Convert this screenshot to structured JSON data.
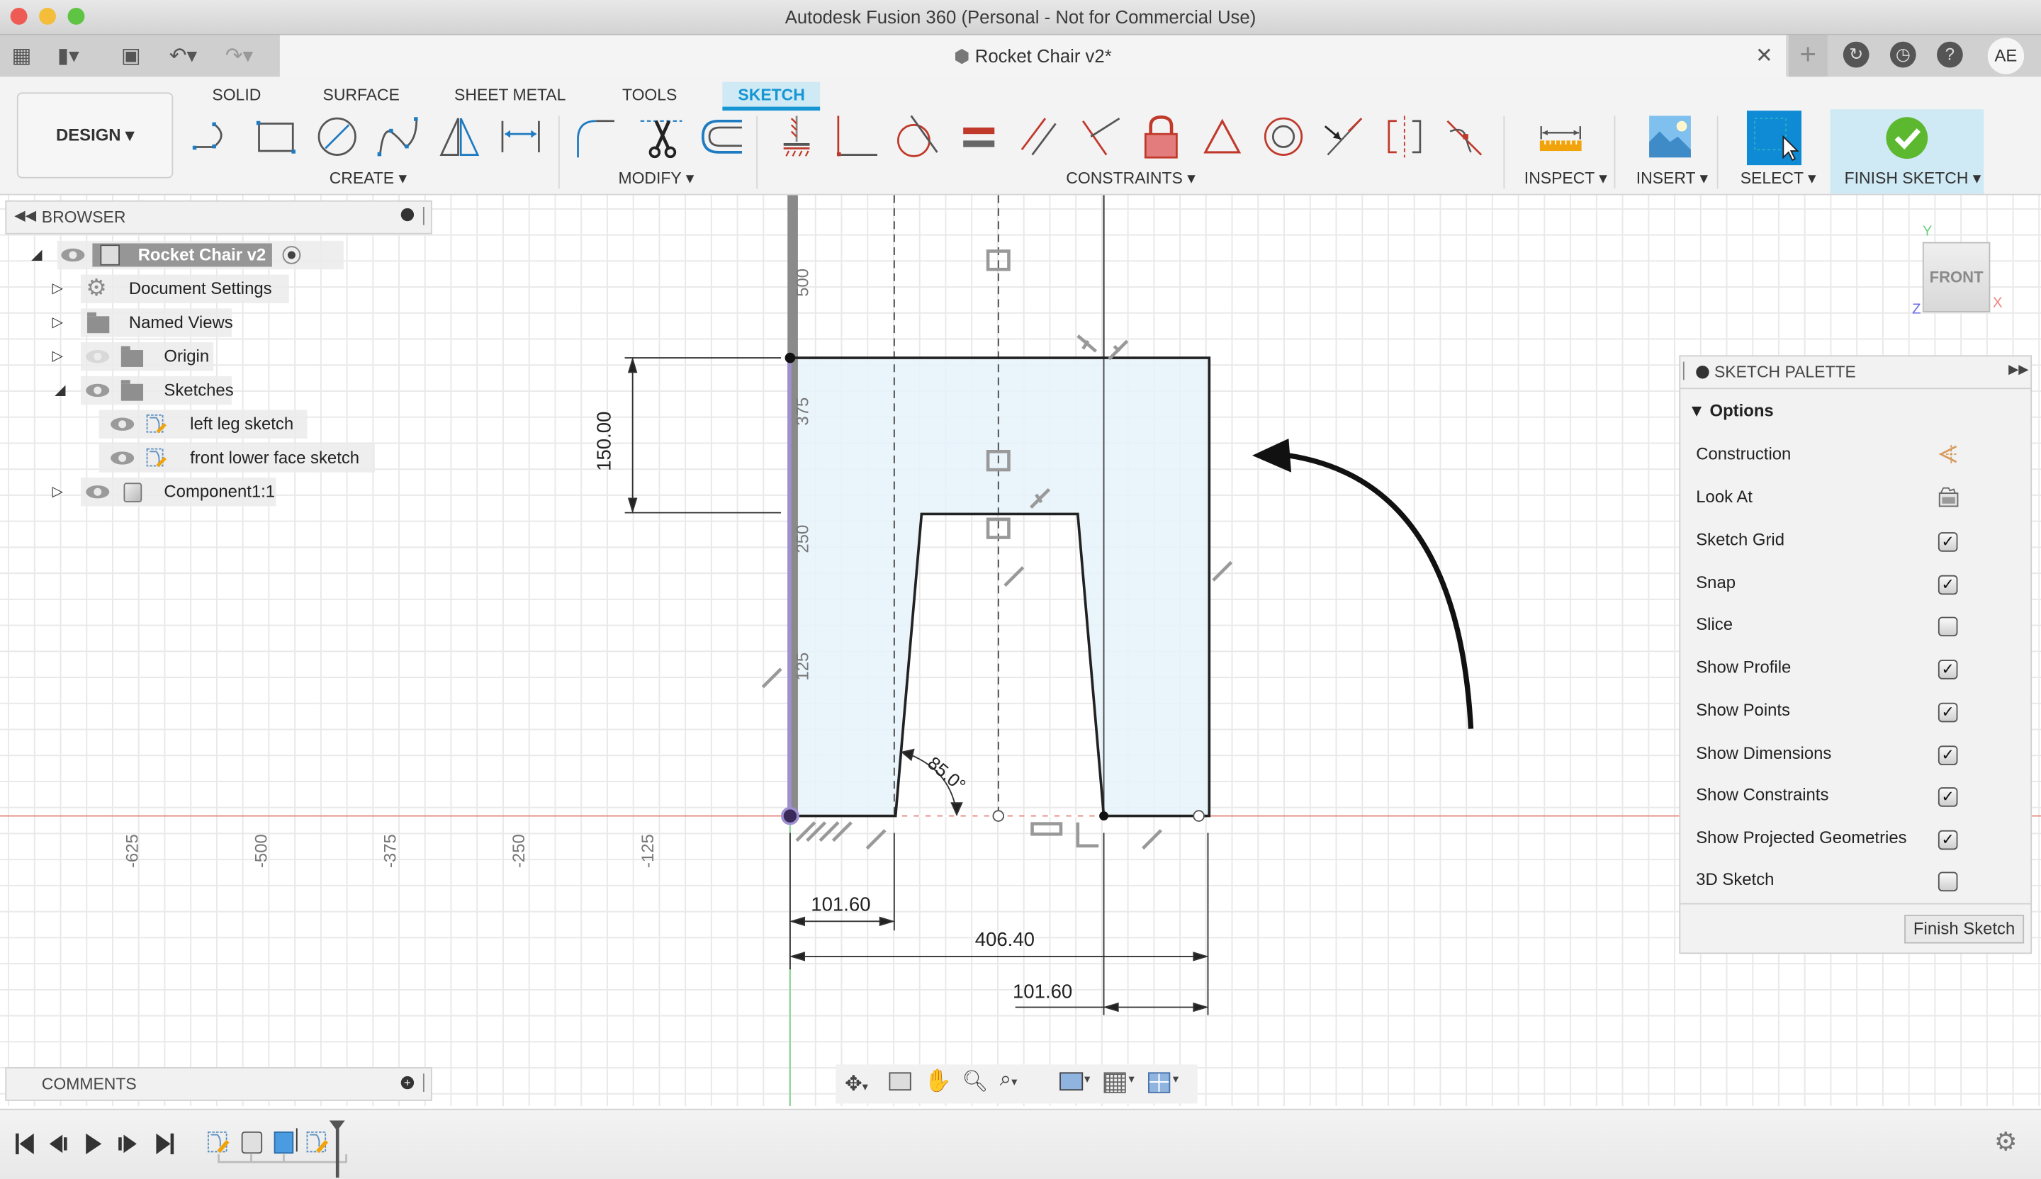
{
  "window": {
    "title": "Autodesk Fusion 360 (Personal - Not for Commercial Use)",
    "document_tab": "Rocket Chair v2*",
    "avatar_initials": "AE"
  },
  "ribbon": {
    "workspace": "DESIGN",
    "tabs": [
      {
        "label": "SOLID",
        "active": false
      },
      {
        "label": "SURFACE",
        "active": false
      },
      {
        "label": "SHEET METAL",
        "active": false
      },
      {
        "label": "TOOLS",
        "active": false
      },
      {
        "label": "SKETCH",
        "active": true
      }
    ],
    "groups": {
      "create": "CREATE",
      "modify": "MODIFY",
      "constraints": "CONSTRAINTS",
      "inspect": "INSPECT",
      "insert": "INSERT",
      "select": "SELECT",
      "finish_sketch": "FINISH SKETCH"
    },
    "create_tools": [
      "line-icon",
      "rectangle-icon",
      "circle-icon",
      "spline-icon",
      "mirror-icon",
      "dimension-icon"
    ],
    "modify_tools": [
      "fillet-icon",
      "trim-icon",
      "offset-icon"
    ],
    "constraint_tools": [
      "fix-icon",
      "coincident-icon",
      "tangent-icon",
      "equal-icon",
      "parallel-icon",
      "perpendicular-icon",
      "lock-icon",
      "horizontal-vertical-icon",
      "concentric-icon",
      "midpoint-icon",
      "symmetry-icon",
      "curvature-icon"
    ],
    "colors": {
      "accent": "#1596d3",
      "finish_green": "#5cb82e",
      "constraint_red": "#c0392b",
      "inspect_orange": "#f0a30a"
    }
  },
  "browser": {
    "title": "BROWSER",
    "items": [
      {
        "label": "Rocket Chair v2",
        "level": 0,
        "expanded": true,
        "icon": "component-icon",
        "visible": true,
        "selected": true
      },
      {
        "label": "Document Settings",
        "level": 1,
        "expanded": false,
        "icon": "gear-icon"
      },
      {
        "label": "Named Views",
        "level": 1,
        "expanded": false,
        "icon": "folder-icon"
      },
      {
        "label": "Origin",
        "level": 1,
        "expanded": false,
        "icon": "folder-icon",
        "visible": false
      },
      {
        "label": "Sketches",
        "level": 1,
        "expanded": true,
        "icon": "folder-icon",
        "visible": true
      },
      {
        "label": "left leg sketch",
        "level": 2,
        "icon": "sketch-icon",
        "visible": true
      },
      {
        "label": "front lower face sketch",
        "level": 2,
        "icon": "sketch-icon",
        "visible": true
      },
      {
        "label": "Component1:1",
        "level": 1,
        "expanded": false,
        "icon": "body-icon",
        "visible": true
      }
    ]
  },
  "comments": {
    "title": "COMMENTS"
  },
  "viewcube": {
    "face": "FRONT",
    "axes": [
      "Y",
      "X",
      "Z"
    ]
  },
  "sketch": {
    "dimensions": {
      "height": "150.00",
      "left_leg_width": "101.60",
      "total_width": "406.40",
      "right_leg_width": "101.60",
      "angle": "85.0°"
    },
    "x_ticks": [
      "-625",
      "-500",
      "-375",
      "-250",
      "-125"
    ],
    "y_ticks": [
      "500",
      "375",
      "250",
      "125"
    ]
  },
  "palette": {
    "title": "SKETCH PALETTE",
    "section": "Options",
    "rows": [
      {
        "label": "Construction",
        "type": "icon",
        "icon": "construction-icon"
      },
      {
        "label": "Look At",
        "type": "icon",
        "icon": "look-at-icon"
      },
      {
        "label": "Sketch Grid",
        "type": "check",
        "checked": true
      },
      {
        "label": "Snap",
        "type": "check",
        "checked": true
      },
      {
        "label": "Slice",
        "type": "check",
        "checked": false
      },
      {
        "label": "Show Profile",
        "type": "check",
        "checked": true
      },
      {
        "label": "Show Points",
        "type": "check",
        "checked": true
      },
      {
        "label": "Show Dimensions",
        "type": "check",
        "checked": true
      },
      {
        "label": "Show Constraints",
        "type": "check",
        "checked": true
      },
      {
        "label": "Show Projected Geometries",
        "type": "check",
        "checked": true
      },
      {
        "label": "3D Sketch",
        "type": "check",
        "checked": false
      }
    ],
    "finish_button": "Finish Sketch"
  },
  "navbar": {
    "tools": [
      "orbit-icon",
      "look-at-icon",
      "pan-icon",
      "zoom-icon",
      "fit-icon",
      "display-settings-icon",
      "grid-settings-icon",
      "viewports-icon"
    ]
  },
  "timeline": {
    "controls": [
      "first-icon",
      "previous-icon",
      "play-icon",
      "next-icon",
      "last-icon"
    ],
    "features": [
      "sketch-feature-icon",
      "body-feature-icon",
      "extrude-feature-icon",
      "sketch-feature-icon"
    ]
  }
}
